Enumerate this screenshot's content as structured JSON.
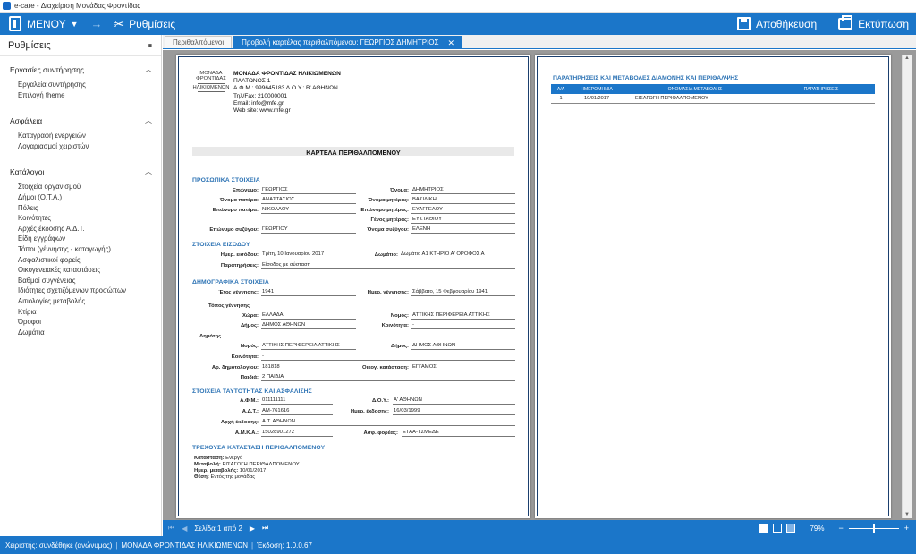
{
  "window": {
    "title": "e-care - Διαχείριση Μονάδας Φροντίδας"
  },
  "menubar": {
    "menu_label": "ΜΕΝΟΥ",
    "settings_label": "Ρυθμίσεις",
    "save_label": "Αποθήκευση",
    "print_label": "Εκτύπωση"
  },
  "sidebar": {
    "title": "Ρυθμίσεις",
    "groups": [
      {
        "label": "Εργασίες συντήρησης",
        "items": [
          "Εργαλεία συντήρησης",
          "Επιλογή theme"
        ]
      },
      {
        "label": "Ασφάλεια",
        "items": [
          "Καταγραφή ενεργειών",
          "Λογαριασμοί χειριστών"
        ]
      },
      {
        "label": "Κατάλογοι",
        "items": [
          "Στοιχεία οργανισμού",
          "Δήμοι (Ο.Τ.Α.)",
          "Πόλεις",
          "Κοινότητες",
          "Αρχές έκδοσης Α.Δ.Τ.",
          "Είδη εγγράφων",
          "Τόποι (γέννησης - καταγωγής)",
          "Ασφαλιστικοί φορείς",
          "Οικογενειακές καταστάσεις",
          "Βαθμοί συγγένειας",
          "Ιδιότητες σχετιζόμενων προσώπων",
          "Αιτιολογίες μεταβολής",
          "Κτίρια",
          "Όροφοι",
          "Δωμάτια"
        ]
      }
    ]
  },
  "tabs": [
    {
      "label": "Περιθαλπόμενοι"
    },
    {
      "label": "Προβολή καρτέλας περιθαλπόμενου: ΓΕΩΡΓΙΟΣ ΔΗΜΗΤΡΙΟΣ",
      "close": "✕"
    }
  ],
  "report": {
    "logo_text": [
      "ΜΟΝΑΔΑ",
      "ΦΡΟΝΤΙΔΑΣ",
      "ΗΛΙΚΙΩΜΕΝΩΝ"
    ],
    "org_name": "ΜΟΝΑΔΑ ΦΡΟΝΤΙΔΑΣ ΗΛΙΚΙΩΜΕΝΩΝ",
    "org_lines": [
      "ΠΛΑΤΩΝΟΣ 1",
      "Α.Φ.Μ.: 999645183 Δ.Ο.Υ.: Β' ΑΘΗΝΩΝ",
      "Τηλ/Fax: 210000001",
      "Email: info@mfe.gr",
      "Web site: www.mfe.gr"
    ],
    "sheet_title": "ΚΑΡΤΕΛΑ ΠΕΡΙΘΑΛΠΟΜΕΝΟΥ",
    "sections": {
      "personal": "ΠΡΟΣΩΠΙΚΑ ΣΤΟΙΧΕΙΑ",
      "entry": "ΣΤΟΙΧΕΙΑ ΕΙΣΟΔΟΥ",
      "demographic": "ΔΗΜΟΓΡΑΦΙΚΑ ΣΤΟΙΧΕΙΑ",
      "identity": "ΣΤΟΙΧΕΙΑ ΤΑΥΤΟΤΗΤΑΣ ΚΑΙ ΑΣΦΑΛΙΣΗΣ",
      "current": "ΤΡΕΧΟΥΣΑ ΚΑΤΑΣΤΑΣΗ ΠΕΡΙΘΑΛΠΟΜΕΝΟΥ"
    },
    "fields": {
      "surname_l": "Επώνυμο:",
      "surname": "ΓΕΩΡΓΙΟΣ",
      "name_l": "Όνομα:",
      "name": "ΔΗΜΗΤΡΙΟΣ",
      "father_l": "Όνομα πατέρα:",
      "father": "ΑΝΑΣΤΑΣΙΟΣ",
      "mother_l": "Όνομα μητέρας:",
      "mother": "ΒΑΣΙΛΙΚΗ",
      "father_sn_l": "Επώνυμο πατέρα:",
      "father_sn": "ΝΙΚΟΛΑΟΥ",
      "mother_sn_l": "Επώνυμο μητέρας:",
      "mother_sn": "ΕΥΑΓΓΕΛΟΥ",
      "gender_l": "Γένος μητέρας:",
      "gender": "ΕΥΣΤΑΘΙΟΥ",
      "spouse_sn_l": "Επώνυμο συζύγου:",
      "spouse_sn": "ΓΕΩΡΓΙΟΥ",
      "spouse_l": "Όνομα συζύγου:",
      "spouse": "ΕΛΕΝΗ",
      "entry_date_l": "Ημερ. εισόδου:",
      "entry_date": "Τρίτη, 10 Ιανουαρίου 2017",
      "room_l": "Δωμάτιο:",
      "room": "Δωμάτιο Α1 ΚΤΗΡΙΟ Α'  ΟΡΟΦΟΣ Α",
      "notes_l": "Παρατηρήσεις:",
      "notes": "Είσοδος με σύσταση",
      "birth_year_l": "Έτος γέννησης:",
      "birth_year": "1941",
      "birth_date_l": "Ημερ. γέννησης:",
      "birth_date": "Σάββατο, 15 Φεβρουαρίου 1941",
      "birthplace_l": "Τόπος γέννησης",
      "country_l": "Χώρα:",
      "country": "ΕΛΛΑΔΑ",
      "prefecture_l": "Νομός:",
      "prefecture": "ΑΤΤΙΚΗΣ  ΠΕΡΙΦΕΡΕΙΑ  ΑΤΤΙΚΗΣ",
      "municipality_l": "Δήμος:",
      "municipality": "ΔΗΜΟΣ ΑΘΗΝΩΝ",
      "community_l": "Κοινότητα:",
      "community": "-",
      "registry_l": "Δημότης",
      "reg_prefecture_l": "Νομός:",
      "reg_prefecture": "ΑΤΤΙΚΗΣ  ΠΕΡΙΦΕΡΕΙΑ  ΑΤΤΙΚΗΣ",
      "reg_municipality_l": "Δήμος:",
      "reg_municipality": "ΔΗΜΟΣ ΑΘΗΝΩΝ",
      "reg_community_l": "Κοινότητα:",
      "reg_community": "-",
      "reg_no_l": "Αρ. δημοτολογίου:",
      "reg_no": "181818",
      "marital_l": "Οικογ. κατάσταση:",
      "marital": "ΕΓΓΑΜΟΣ",
      "children_l": "Παιδιά:",
      "children": "2 ΠΑΙΔΙΑ",
      "afm_l": "Α.Φ.Μ.:",
      "afm": "011111111",
      "doy_l": "Δ.Ο.Υ.:",
      "doy": "Α' ΑΘΗΝΩΝ",
      "adt_l": "Α.Δ.Τ.:",
      "adt": "ΑΜ-761616",
      "issue_date_l": "Ημερ. έκδοσης:",
      "issue_date": "16/03/1999",
      "authority_l": "Αρχή έκδοσης:",
      "authority": "Α.Τ. ΑΘΗΝΩΝ",
      "amka_l": "Α.Μ.Κ.Α.:",
      "amka": "15028901272",
      "insurer_l": "Ασφ. φορέας:",
      "insurer": "ΕΤΑΑ-ΤΣΜΕΔΕ",
      "status_l": "Κατάσταση:",
      "status": "Ενεργό",
      "change_l": "Μεταβολή:",
      "change": "ΕΙΣΑΓΩΓΗ ΠΕΡΙΘΑΛΠΟΜΕΝΟΥ",
      "change_date_l": "Ημερ. μεταβολής:",
      "change_date": "10/01/2017",
      "position_l": "Θέση:",
      "position": "Εντός της μονάδας"
    },
    "page2": {
      "title": "ΠΑΡΑΤΗΡΗΣΕΙΣ ΚΑΙ ΜΕΤΑΒΟΛΕΣ ΔΙΑΜΟΝΗΣ ΚΑΙ ΠΕΡΙΘΑΛΨΗΣ",
      "headers": [
        "Α/Α",
        "ΗΜΕΡΟΜΗΝΙΑ",
        "ΟΝΟΜΑΣΙΑ  ΜΕΤΑΒΟΛΗΣ",
        "ΠΑΡΑΤΗΡΗΣΕΙΣ"
      ],
      "rows": [
        [
          "1",
          "10/01/2017",
          "ΕΙΣΑΓΩΓΗ ΠΕΡΙΘΑΛΠΟΜΕΝΟΥ",
          ""
        ]
      ]
    }
  },
  "viewer": {
    "page_label": "Σελίδα 1 από 2",
    "zoom": "79%",
    "zoom_minus": "−",
    "zoom_plus": "+"
  },
  "status": {
    "user": "Χειριστής: συνδέθηκε (ανώνυμος)",
    "unit": "ΜΟΝΑΔΑ ΦΡΟΝΤΙΔΑΣ ΗΛΙΚΙΩΜΕΝΩΝ",
    "version": "Έκδοση: 1.0.0.67"
  },
  "colors": {
    "accent": "#1b76c9",
    "section": "#2e74b5"
  }
}
